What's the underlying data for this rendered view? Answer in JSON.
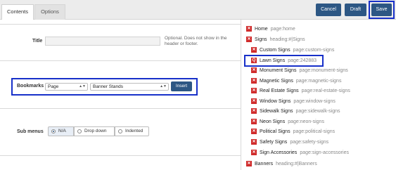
{
  "tabs": [
    {
      "label": "Contents",
      "active": true
    },
    {
      "label": "Options",
      "active": false
    }
  ],
  "toolbar": {
    "cancel_label": "Cancel",
    "draft_label": "Draft",
    "save_label": "Save"
  },
  "colors": {
    "primary": "#2d5784",
    "highlight": "#1730c9",
    "badge": "#d02c2c"
  },
  "title_field": {
    "label": "Title",
    "value": "",
    "hint": "Optional. Does not show in the header or footer."
  },
  "bookmarks": {
    "label": "Bookmarks",
    "type_value": "Page",
    "page_value": "Banner Stands",
    "insert_label": "Insert"
  },
  "submenus": {
    "label": "Sub menus",
    "options": [
      "N/A",
      "Drop down",
      "Indented"
    ],
    "selected": "N/A"
  },
  "pages": [
    {
      "title": "Home",
      "meta": "page:home",
      "icon": "x-icon"
    },
    {
      "title": "Signs",
      "meta": "heading:#|Signs",
      "icon": "x-icon"
    },
    {
      "title": "Custom Signs",
      "meta": "page:custom-signs",
      "icon": "x-icon"
    },
    {
      "title": "Lawn Signs",
      "meta": "page:242883",
      "icon": "q-icon"
    },
    {
      "title": "Monument Signs",
      "meta": "page:monument-signs",
      "icon": "x-icon"
    },
    {
      "title": "Magnetic Signs",
      "meta": "page:magnetic-signs",
      "icon": "x-icon"
    },
    {
      "title": "Real Estate Signs",
      "meta": "page:real-estate-signs",
      "icon": "x-icon"
    },
    {
      "title": "Window Signs",
      "meta": "page:window-signs",
      "icon": "x-icon"
    },
    {
      "title": "Sidewalk Signs",
      "meta": "page:sidewalk-signs",
      "icon": "x-icon"
    },
    {
      "title": "Neon Signs",
      "meta": "page:neon-signs",
      "icon": "x-icon"
    },
    {
      "title": "Political Signs",
      "meta": "page:political-signs",
      "icon": "x-icon"
    },
    {
      "title": "Safety Signs",
      "meta": "page:safety-signs",
      "icon": "x-icon"
    },
    {
      "title": "Sign Accessories",
      "meta": "page:sign-accessories",
      "icon": "x-icon"
    },
    {
      "title": "Banners",
      "meta": "heading:#|Banners",
      "icon": "x-icon"
    }
  ]
}
